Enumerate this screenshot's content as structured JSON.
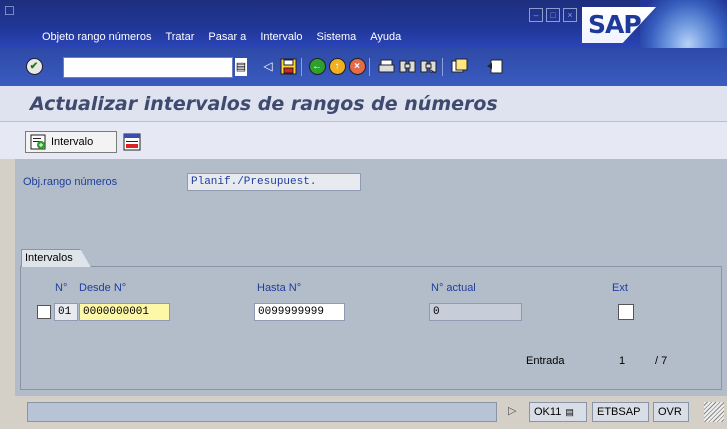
{
  "menubar": {
    "items": [
      "Objeto rango números",
      "Tratar",
      "Pasar a",
      "Intervalo",
      "Sistema",
      "Ayuda"
    ],
    "logo": "SAP"
  },
  "toolbar": {
    "command_value": "",
    "icons": [
      "enter-icon",
      "save-icon",
      "back-icon",
      "exit-icon",
      "cancel-icon",
      "print-icon",
      "find-icon",
      "find-next-icon",
      "create-session-icon",
      "shortcut-icon"
    ]
  },
  "page": {
    "title": "Actualizar intervalos de rangos de números"
  },
  "app_toolbar": {
    "intervalo_label": "Intervalo"
  },
  "form": {
    "obj_label": "Obj.rango números",
    "obj_value": "Planif./Presupuest."
  },
  "intervals": {
    "group_title": "Intervalos",
    "headers": {
      "no": "N°",
      "desde": "Desde N°",
      "hasta": "Hasta N°",
      "actual": "N° actual",
      "ext": "Ext"
    },
    "row": {
      "no": "01",
      "desde": "0000000001",
      "hasta": "0099999999",
      "actual": "0"
    },
    "entrada_label": "Entrada",
    "entrada_current": "1",
    "entrada_total": "/ 7"
  },
  "statusbar": {
    "transaction": "OK11",
    "system": "ETBSAP",
    "mode": "OVR"
  }
}
